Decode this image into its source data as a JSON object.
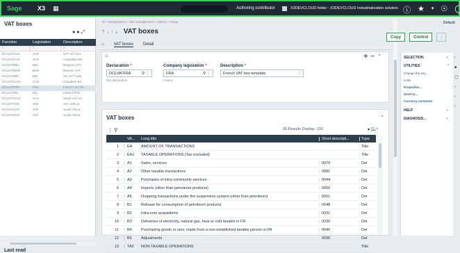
{
  "topbar": {
    "logo": "Sage",
    "app": "X3",
    "user": "Authoring contributor",
    "folder": "X3DEVCLOUD folder : X3DEVCLOUD Industrialization solution"
  },
  "left": {
    "title": "VAT boxes",
    "columns": [
      "Function",
      "Legislation",
      "Description"
    ],
    "rows": [
      [
        "DCLVATAUS",
        "AUS",
        "VAT VAT box"
      ],
      [
        "DCLVATAUS",
        "AUS",
        "Australian BS"
      ],
      [
        "DCLVATBEL",
        "BEL",
        "Belgium VAT"
      ],
      [
        "DCLVATBHR",
        "BHR",
        "Bahrain VAT"
      ],
      [
        "DCLVATBRI",
        "BRI",
        "UK VAT code"
      ],
      [
        "DCLVATCAN",
        "CAN",
        "Canadian BA"
      ],
      [
        "DCLVATFRA",
        "FRA",
        "French VAT bo"
      ],
      [
        "DCLVATIRL",
        "IRL",
        "Ireland RTD"
      ],
      [
        "DCLVATSAU",
        "SAU",
        "Saudi VAT bo"
      ],
      [
        "DCLVATSWI",
        "SWI",
        "VAT without"
      ],
      [
        "DCLVATZAF",
        "ZAF",
        "South Africa"
      ],
      [
        "DCLVATZAF",
        "ZAF",
        "South Africa"
      ]
    ],
    "selected_row": 6,
    "last_read": "Last read"
  },
  "main": {
    "breadcrumb": "All > Declarations > Tax management > Others > Setup",
    "title": "VAT boxes",
    "tabs": [
      "VAT boxes",
      "Detail"
    ],
    "fields": {
      "declaration": {
        "label": "Declaration",
        "value": "DCLVATFRA",
        "sub": "Tax declaration"
      },
      "legislation": {
        "label": "Company legislation",
        "value": "FRA",
        "sub": "France"
      },
      "description": {
        "label": "Description",
        "value": "French VAT box template"
      }
    },
    "grid": {
      "title": "VAT boxes",
      "results": "95 Results  Display: 100",
      "headers": [
        "VA...",
        "Long title",
        "Short descripti...",
        "Type"
      ],
      "rows": [
        [
          "1",
          "EA",
          "AMOUNT OF TRANSACTIONS",
          "",
          "Title"
        ],
        [
          "2",
          "EA1",
          "TAXABLE OPERATIONS (Tax excluded)",
          "",
          "Title"
        ],
        [
          "3",
          "A1",
          "Sales, services",
          "0979",
          "Det"
        ],
        [
          "4",
          "A2",
          "Other taxable transactions",
          "0981",
          "Det"
        ],
        [
          "5",
          "A3",
          "Purchases of intra-community services",
          "0044",
          "Det"
        ],
        [
          "6",
          "A4",
          "Imports (other than petroleum products)",
          "0056",
          "Det"
        ],
        [
          "7",
          "A5",
          "Outgoing transactions under the suspension system (other than petroleum)",
          "0051",
          "Det"
        ],
        [
          "8",
          "B1",
          "Release for consumption of petroleum products",
          "0048",
          "Det"
        ],
        [
          "9",
          "B2",
          "Intra-com acquisitions",
          "0031",
          "Det"
        ],
        [
          "10",
          "B3",
          "Deliveries of electricity, natural gas, heat or cold taxable in FR",
          "0030",
          "Det"
        ],
        [
          "11",
          "B4",
          "Purchasing goods or serv. made from a non-established taxable person in FR",
          "0040",
          "Det"
        ],
        [
          "12",
          "B5",
          "Adjustments",
          "0036",
          "Det"
        ],
        [
          "13",
          "TA2",
          "NON-TAXABLE OPERATIONS",
          "",
          "Title"
        ]
      ]
    }
  },
  "actions": {
    "copy": "Copy",
    "control": "Control",
    "default": "Default"
  },
  "rpanel": {
    "selection": "SELECTION",
    "utilities": "UTILITIES",
    "util_items": [
      "Change the key...",
      "Links",
      "Properties...",
      "Send to...",
      "Currency converter"
    ],
    "help": "HELP",
    "diagnosis": "DIAGNOSIS..."
  }
}
